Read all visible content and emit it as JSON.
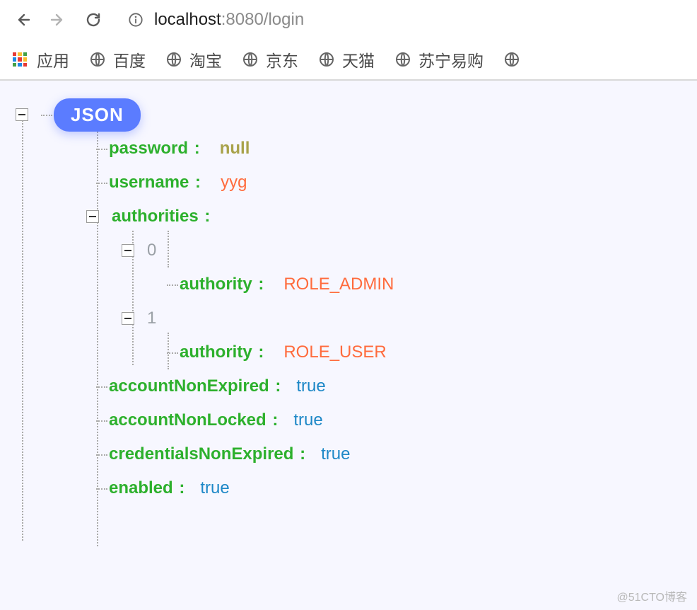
{
  "browser": {
    "url_host": "localhost",
    "url_rest": ":8080/login"
  },
  "bookmarks": {
    "apps_label": "应用",
    "items": [
      "百度",
      "淘宝",
      "京东",
      "天猫",
      "苏宁易购"
    ]
  },
  "json_tree": {
    "root_label": "JSON",
    "password": {
      "key": "password",
      "value": "null"
    },
    "username": {
      "key": "username",
      "value": "yyg"
    },
    "authorities": {
      "key": "authorities",
      "items": [
        {
          "index": "0",
          "authority_key": "authority",
          "authority_value": "ROLE_ADMIN"
        },
        {
          "index": "1",
          "authority_key": "authority",
          "authority_value": "ROLE_USER"
        }
      ]
    },
    "accountNonExpired": {
      "key": "accountNonExpired",
      "value": "true"
    },
    "accountNonLocked": {
      "key": "accountNonLocked",
      "value": "true"
    },
    "credentialsNonExpired": {
      "key": "credentialsNonExpired",
      "value": "true"
    },
    "enabled": {
      "key": "enabled",
      "value": "true"
    }
  },
  "watermark": "@51CTO博客"
}
